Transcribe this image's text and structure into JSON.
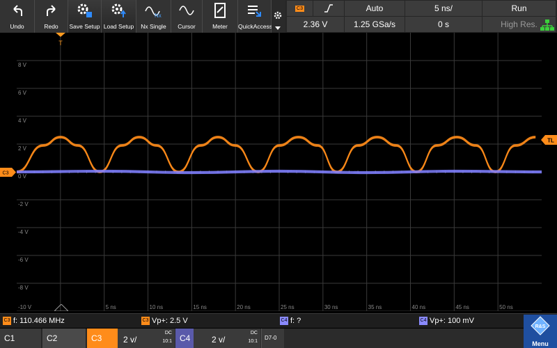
{
  "toolbar": {
    "buttons": [
      {
        "id": "undo",
        "label": "Undo",
        "icon": "undo-icon"
      },
      {
        "id": "redo",
        "label": "Redo",
        "icon": "redo-icon"
      },
      {
        "id": "save-setup",
        "label": "Save Setup",
        "icon": "save-setup-icon"
      },
      {
        "id": "load-setup",
        "label": "Load Setup",
        "icon": "load-setup-icon"
      },
      {
        "id": "nx-single",
        "label": "Nx Single",
        "icon": "nx-single-icon"
      },
      {
        "id": "cursor",
        "label": "Cursor",
        "icon": "cursor-icon"
      },
      {
        "id": "meter",
        "label": "Meter",
        "icon": "meter-icon"
      },
      {
        "id": "quickaccess",
        "label": "QuickAccess",
        "icon": "quickaccess-icon"
      }
    ],
    "nx_icon_text": "Nx"
  },
  "status": {
    "trigger_source_badge": "C3",
    "trigger_level": "2.36 V",
    "trigger_mode": "Auto",
    "sample_rate": "1.25 GSa/s",
    "time_scale": "5 ns/",
    "time_offset": "0 s",
    "run_state": "Run",
    "acquisition_mode": "High Res."
  },
  "markers": {
    "trigger_time": "T",
    "trigger_level_label": "TL",
    "channel_marker": "C3"
  },
  "plot": {
    "y_labels": [
      "8 V",
      "6 V",
      "4 V",
      "2 V",
      "0 V",
      "-2 V",
      "-4 V",
      "-6 V",
      "-8 V",
      "-10 V"
    ],
    "x_labels": [
      "5 ns",
      "10 ns",
      "15 ns",
      "20 ns",
      "25 ns",
      "30 ns",
      "35 ns",
      "40 ns",
      "45 ns",
      "50 ns"
    ]
  },
  "measurements": [
    {
      "badge": "C3",
      "text": "f: 110.466 MHz",
      "color": "#ff8c1a"
    },
    {
      "badge": "C3",
      "text": "Vp+: 2.5 V",
      "color": "#ff8c1a"
    },
    {
      "badge": "C4",
      "text": "f: ?",
      "color": "#8a8aff"
    },
    {
      "badge": "C4",
      "text": "Vp+: 100 mV",
      "color": "#8a8aff"
    }
  ],
  "channels": [
    {
      "name": "C1"
    },
    {
      "name": "C2"
    },
    {
      "name": "C3",
      "scale": "2 v/",
      "coupling": "DC",
      "probe": "10:1"
    },
    {
      "name": "C4",
      "scale": "2 v/",
      "coupling": "DC",
      "probe": "10:1"
    },
    {
      "name": "D7-0"
    }
  ],
  "menu": {
    "label": "Menu",
    "logo_text": "R&S"
  },
  "colors": {
    "ch3": "#ff8c1a",
    "ch4": "#7f7fff",
    "grid": "#3a3a3a",
    "trigger_marker": "#ff9a1f",
    "lan_icon": "#3bd13b"
  },
  "chart_data": {
    "type": "line",
    "xlabel": "",
    "ylabel": "",
    "xlim": [
      -5,
      55
    ],
    "ylim": [
      -10,
      10
    ],
    "x_ticks": [
      5,
      10,
      15,
      20,
      25,
      30,
      35,
      40,
      45,
      50
    ],
    "y_ticks": [
      8,
      6,
      4,
      2,
      0,
      -2,
      -4,
      -6,
      -8,
      -10
    ],
    "grid": true,
    "series": [
      {
        "name": "C3",
        "color": "#ff8c1a",
        "frequency_mhz": 110.466,
        "peak_v": 2.5,
        "min_v": 0.0,
        "samples": [
          {
            "t": -5.0,
            "v": 0.0
          },
          {
            "t": -2.0,
            "v": 1.9
          },
          {
            "t": 0.0,
            "v": 2.5
          },
          {
            "t": 2.0,
            "v": 1.9
          },
          {
            "t": 4.5,
            "v": 0.0
          },
          {
            "t": 7.0,
            "v": 1.9
          },
          {
            "t": 9.0,
            "v": 2.5
          },
          {
            "t": 11.0,
            "v": 1.9
          },
          {
            "t": 13.5,
            "v": 0.0
          },
          {
            "t": 16.0,
            "v": 1.9
          },
          {
            "t": 18.0,
            "v": 2.5
          },
          {
            "t": 20.0,
            "v": 1.9
          },
          {
            "t": 22.6,
            "v": 0.0
          },
          {
            "t": 25.0,
            "v": 1.9
          },
          {
            "t": 27.2,
            "v": 2.5
          },
          {
            "t": 29.4,
            "v": 1.9
          },
          {
            "t": 31.6,
            "v": 0.0
          },
          {
            "t": 34.0,
            "v": 1.9
          },
          {
            "t": 36.2,
            "v": 2.5
          },
          {
            "t": 38.4,
            "v": 1.9
          },
          {
            "t": 40.7,
            "v": 0.0
          },
          {
            "t": 43.0,
            "v": 1.9
          },
          {
            "t": 45.3,
            "v": 2.5
          },
          {
            "t": 47.5,
            "v": 1.9
          },
          {
            "t": 49.7,
            "v": 0.0
          },
          {
            "t": 52.0,
            "v": 1.9
          },
          {
            "t": 54.3,
            "v": 2.5
          }
        ]
      },
      {
        "name": "C4",
        "color": "#7f7fff",
        "peak_v": 0.1,
        "samples": [
          {
            "t": -5.0,
            "v": 0.0
          },
          {
            "t": 5.0,
            "v": 0.05
          },
          {
            "t": 15.0,
            "v": -0.05
          },
          {
            "t": 25.0,
            "v": 0.05
          },
          {
            "t": 35.0,
            "v": -0.05
          },
          {
            "t": 45.0,
            "v": 0.05
          },
          {
            "t": 55.0,
            "v": 0.0
          }
        ]
      }
    ]
  }
}
